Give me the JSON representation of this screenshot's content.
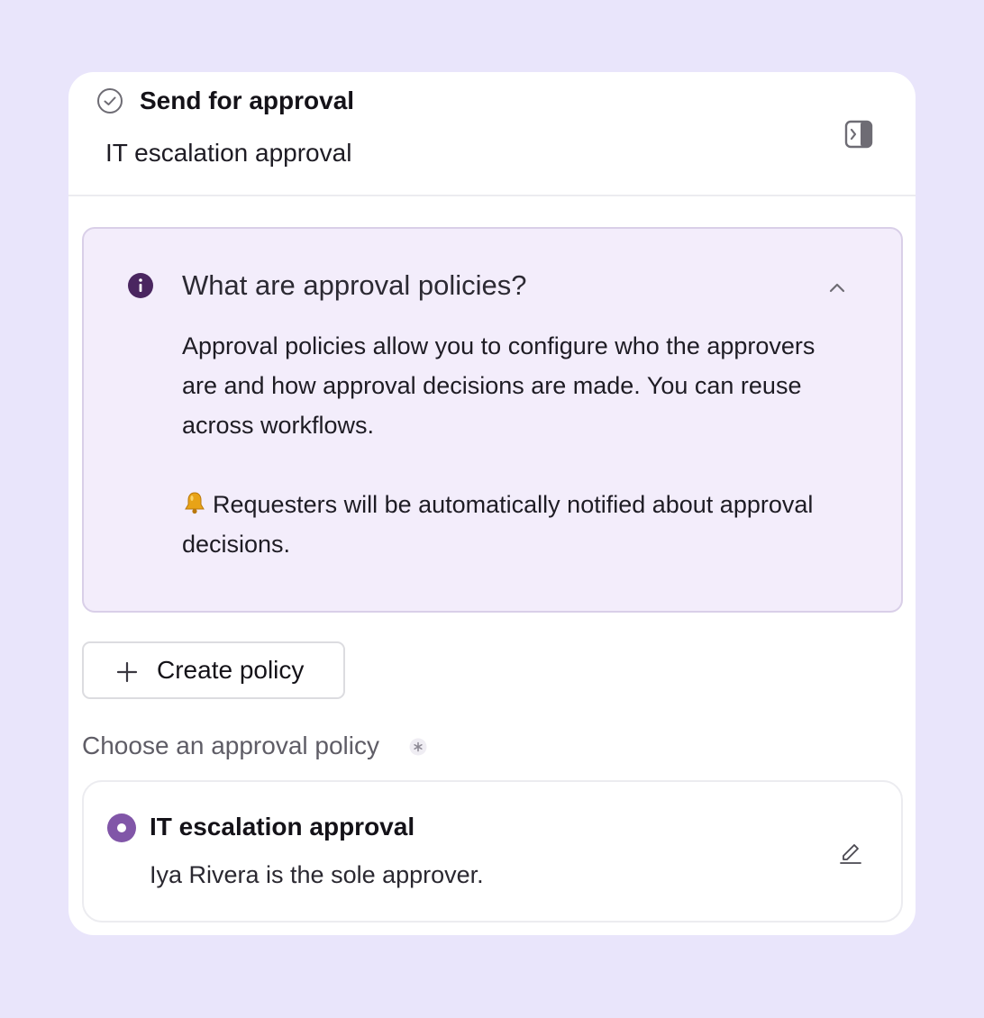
{
  "step": {
    "title": "Send for approval",
    "subtitle": "IT escalation approval",
    "status_icon": "check-circle-icon",
    "toggle_icon": "panel-toggle-icon"
  },
  "info": {
    "title": "What are approval policies?",
    "icon": "info-icon",
    "paragraph1": "Approval policies allow you to configure who the approvers are and how approval decisions are made. You can reuse across workflows.",
    "paragraph2": "Requesters will be automatically notified about approval decisions.",
    "paragraph2_icon": "bell-icon",
    "expanded": true
  },
  "create_button": {
    "label": "Create policy",
    "icon": "plus-icon"
  },
  "policy_selector": {
    "label": "Choose an approval policy",
    "required": true,
    "options": [
      {
        "name": "IT escalation approval",
        "description": "Iya Rivera is the sole approver.",
        "selected": true
      }
    ]
  },
  "colors": {
    "background": "#e9e5fb",
    "accent": "#8156a8",
    "info_bg": "#f3edfb",
    "info_icon": "#4a2660"
  }
}
